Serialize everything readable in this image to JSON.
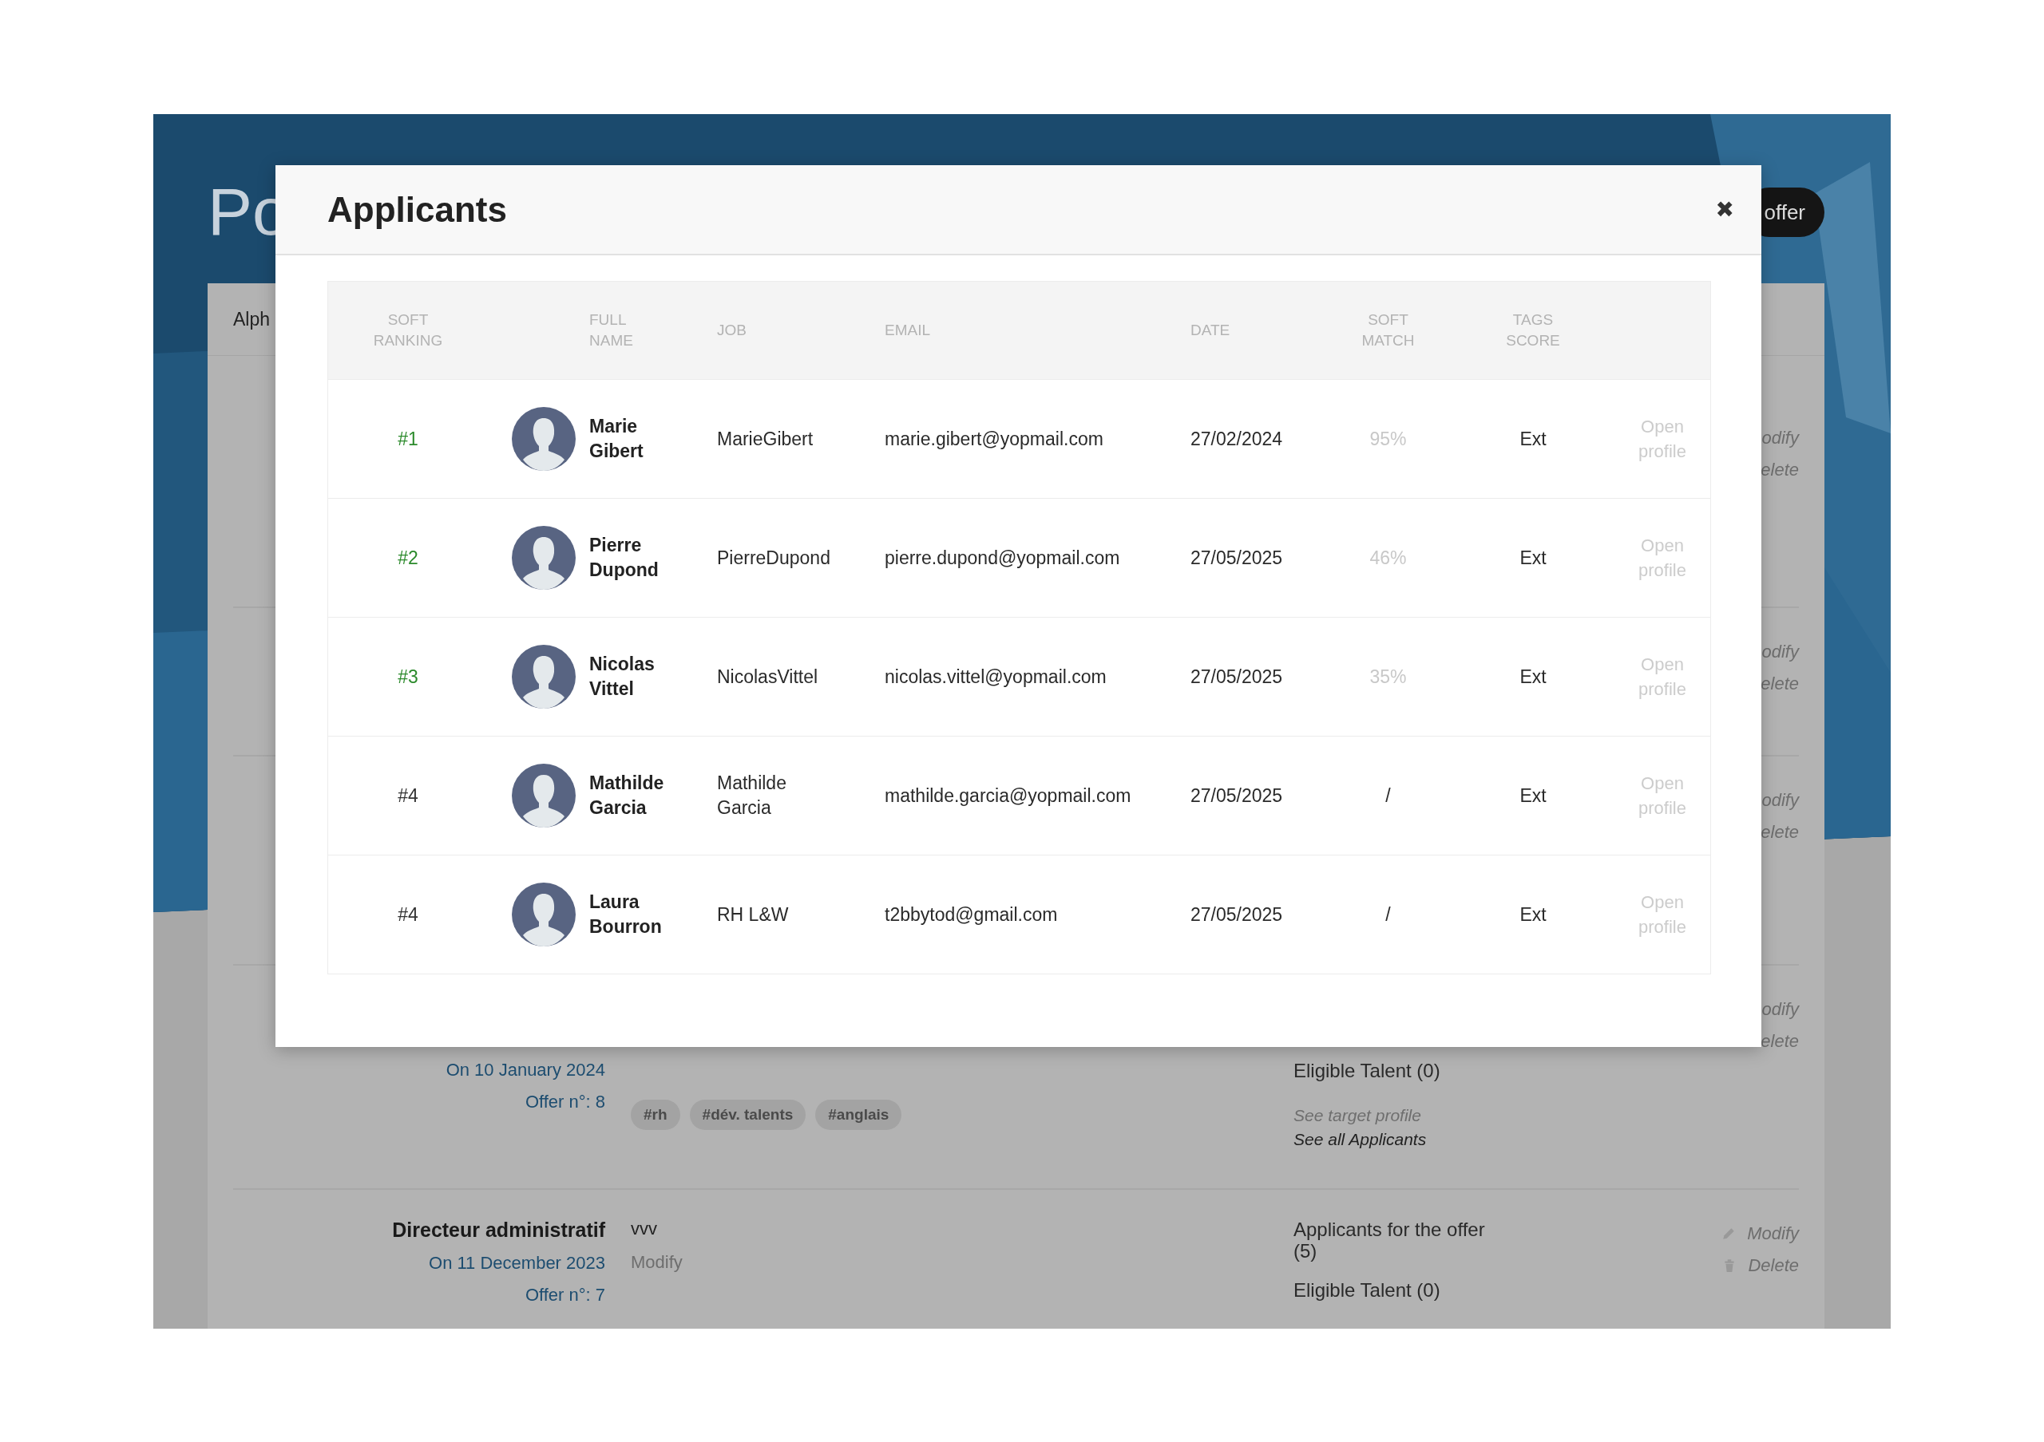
{
  "page": {
    "title": "Po",
    "offer_button": "offer",
    "tab": "Alph"
  },
  "offers": [
    {
      "actions": [
        {
          "label": "odify",
          "kind": "fragment"
        },
        {
          "label": "elete",
          "kind": "fragment"
        }
      ]
    },
    {
      "actions": [
        {
          "label": "odify",
          "kind": "fragment"
        },
        {
          "label": "elete",
          "kind": "fragment"
        }
      ]
    },
    {
      "actions": [
        {
          "label": "odify",
          "kind": "fragment"
        },
        {
          "label": "elete",
          "kind": "fragment"
        }
      ]
    },
    {
      "date": "On 10 January 2024",
      "offer_number": "Offer n°: 8",
      "tags": [
        "#rh",
        "#dév. talents",
        "#anglais"
      ],
      "eligible": "Eligible Talent (0)",
      "target_profile_link": "See target profile",
      "applicants_link": "See all Applicants",
      "actions": [
        {
          "label": "odify",
          "kind": "fragment"
        },
        {
          "label": "elete",
          "kind": "fragment"
        }
      ]
    },
    {
      "title": "Directeur administratif",
      "description": "vvv",
      "modify_link": "Modify",
      "date": "On 11 December 2023",
      "offer_number": "Offer n°: 7",
      "applicants": "Applicants for the offer (5)",
      "eligible": "Eligible Talent (0)",
      "actions": [
        {
          "label": "Modify",
          "kind": "edit"
        },
        {
          "label": "Delete",
          "kind": "delete"
        }
      ]
    }
  ],
  "modal": {
    "title": "Applicants",
    "close": "✖",
    "columns": [
      "SOFT RANKING",
      "FULL NAME",
      "JOB",
      "EMAIL",
      "DATE",
      "SOFT MATCH",
      "TAGS SCORE"
    ],
    "rows": [
      {
        "rank": "#1",
        "highlighted": true,
        "name": "Marie Gibert",
        "job": "MarieGibert",
        "email": "marie.gibert@yopmail.com",
        "date": "27/02/2024",
        "soft_match": "95%",
        "match_muted": true,
        "tags_score": "Ext",
        "link": "Open profile"
      },
      {
        "rank": "#2",
        "highlighted": true,
        "name": "Pierre Dupond",
        "job": "PierreDupond",
        "email": "pierre.dupond@yopmail.com",
        "date": "27/05/2025",
        "soft_match": "46%",
        "match_muted": true,
        "tags_score": "Ext",
        "link": "Open profile"
      },
      {
        "rank": "#3",
        "highlighted": true,
        "name": "Nicolas Vittel",
        "job": "NicolasVittel",
        "email": "nicolas.vittel@yopmail.com",
        "date": "27/05/2025",
        "soft_match": "35%",
        "match_muted": true,
        "tags_score": "Ext",
        "link": "Open profile"
      },
      {
        "rank": "#4",
        "highlighted": false,
        "name": "Mathilde Garcia",
        "job": "Mathilde Garcia",
        "email": "mathilde.garcia@yopmail.com",
        "date": "27/05/2025",
        "soft_match": "/",
        "match_muted": false,
        "tags_score": "Ext",
        "link": "Open profile"
      },
      {
        "rank": "#4",
        "highlighted": false,
        "name": "Laura Bourron",
        "job": "RH L&W",
        "email": "t2bbytod@gmail.com",
        "date": "27/05/2025",
        "soft_match": "/",
        "match_muted": false,
        "tags_score": "Ext",
        "link": "Open profile"
      }
    ]
  }
}
